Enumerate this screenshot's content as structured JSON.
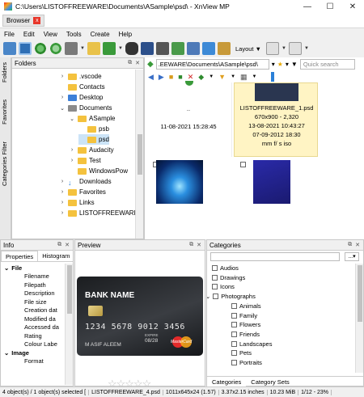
{
  "window": {
    "title": "C:\\Users\\LISTOFFREEWARE\\Documents\\ASample\\psd\\ - XnView MP",
    "min": "—",
    "max": "☐",
    "close": "✕"
  },
  "tab": {
    "label": "Browser",
    "close": "x"
  },
  "menu": [
    "File",
    "Edit",
    "View",
    "Tools",
    "Create",
    "Help"
  ],
  "toolbar": {
    "layout_label": "Layout"
  },
  "sidetabs": [
    "Folders",
    "Favorites",
    "Categories Filter"
  ],
  "folders": {
    "title": "Folders",
    "items": [
      {
        "label": ".vscode",
        "indent": 0,
        "chev": "›",
        "icon": "folder"
      },
      {
        "label": "Contacts",
        "indent": 0,
        "chev": "",
        "icon": "folder"
      },
      {
        "label": "Desktop",
        "indent": 0,
        "chev": "›",
        "icon": "folder-blue"
      },
      {
        "label": "Documents",
        "indent": 0,
        "chev": "⌄",
        "icon": "folder-gray"
      },
      {
        "label": "ASample",
        "indent": 1,
        "chev": "⌄",
        "icon": "folder"
      },
      {
        "label": "psb",
        "indent": 2,
        "chev": "",
        "icon": "folder"
      },
      {
        "label": "psd",
        "indent": 2,
        "chev": "",
        "icon": "folder"
      },
      {
        "label": "Audacity",
        "indent": 1,
        "chev": "›",
        "icon": "folder"
      },
      {
        "label": "Test",
        "indent": 1,
        "chev": "›",
        "icon": "folder"
      },
      {
        "label": "WindowsPow",
        "indent": 1,
        "chev": "",
        "icon": "folder"
      },
      {
        "label": "Downloads",
        "indent": 0,
        "chev": "›",
        "icon": "download"
      },
      {
        "label": "Favorites",
        "indent": 0,
        "chev": "›",
        "icon": "folder"
      },
      {
        "label": "Links",
        "indent": 0,
        "chev": "›",
        "icon": "folder"
      },
      {
        "label": "LISTOFFREEWARE",
        "indent": 0,
        "chev": "›",
        "icon": "folder"
      }
    ]
  },
  "browser": {
    "address": ".EEWARE\\Documents\\ASample\\psd\\",
    "quick_search": "Quick search",
    "cells": {
      "left_dots": "..",
      "left_date": "11-08-2021 15:28:45",
      "right_name": "LISTOFFREEWARE_1.psd",
      "right_dims": "670x900 - 2,320",
      "right_date1": "13-08-2021 10:43:27",
      "right_date2": "07-09-2012 18:30",
      "right_meta": "mm f/ s iso"
    }
  },
  "info": {
    "title": "Info",
    "tab_properties": "Properties",
    "tab_histogram": "Histogram",
    "rows": [
      {
        "label": "File",
        "bold": true,
        "exp": "⌄"
      },
      {
        "label": "Filename"
      },
      {
        "label": "Filepath"
      },
      {
        "label": "Description"
      },
      {
        "label": "File size"
      },
      {
        "label": "Creation dat"
      },
      {
        "label": "Modified da"
      },
      {
        "label": "Accessed da"
      },
      {
        "label": "Rating"
      },
      {
        "label": "Colour Labe"
      },
      {
        "label": "Image",
        "bold": true,
        "exp": "⌄"
      },
      {
        "label": "Format"
      }
    ]
  },
  "preview": {
    "title": "Preview",
    "card_bank": "BANK NAME",
    "card_number": "1234  5678  9012  3456",
    "card_expiry_label": "EXPIRE",
    "card_expiry": "08/28",
    "card_name": "M ASIF ALEEM",
    "card_brand": "MasterCard",
    "stars": "☆☆☆☆☆"
  },
  "categories": {
    "title": "Categories",
    "items": [
      {
        "label": "Audios",
        "indent": 0
      },
      {
        "label": "Drawings",
        "indent": 0
      },
      {
        "label": "Icons",
        "indent": 0
      },
      {
        "label": "Photographs",
        "indent": 0,
        "exp": "⌄"
      },
      {
        "label": "Animals",
        "indent": 1
      },
      {
        "label": "Family",
        "indent": 1
      },
      {
        "label": "Flowers",
        "indent": 1
      },
      {
        "label": "Friends",
        "indent": 1
      },
      {
        "label": "Landscapes",
        "indent": 1
      },
      {
        "label": "Pets",
        "indent": 1
      },
      {
        "label": "Portraits",
        "indent": 1
      }
    ],
    "tab_categories": "Categories",
    "tab_sets": "Category Sets"
  },
  "status": [
    "4 object(s) / 1 object(s) selected [",
    "LISTOFFREEWARE_4.psd",
    "1011x645x24 (1.57)",
    "3.37x2.15 inches",
    "10.23 MiB",
    "1/12 - 23%"
  ]
}
